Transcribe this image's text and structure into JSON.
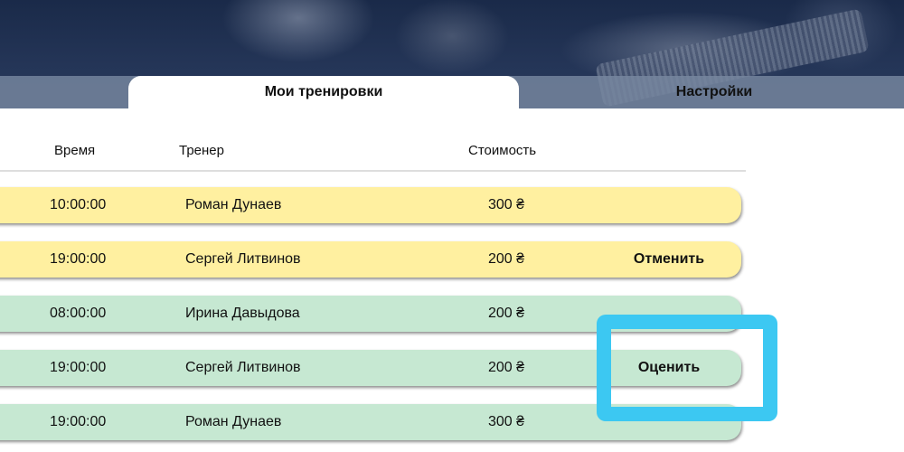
{
  "tabs": {
    "my_trainings": "Мои тренировки",
    "settings": "Настройки"
  },
  "table": {
    "headers": {
      "time": "Время",
      "trainer": "Тренер",
      "cost": "Стоимость"
    },
    "rows": [
      {
        "time": "10:00:00",
        "trainer": "Роман Дунаев",
        "cost": "300 ₴",
        "action": "",
        "status": "upcoming"
      },
      {
        "time": "19:00:00",
        "trainer": "Сергей Литвинов",
        "cost": "200 ₴",
        "action": "Отменить",
        "status": "upcoming"
      },
      {
        "time": "08:00:00",
        "trainer": "Ирина Давыдова",
        "cost": "200 ₴",
        "action": "",
        "status": "completed"
      },
      {
        "time": "19:00:00",
        "trainer": "Сергей Литвинов",
        "cost": "200 ₴",
        "action": "Оценить",
        "status": "completed"
      },
      {
        "time": "19:00:00",
        "trainer": "Роман Дунаев",
        "cost": "300 ₴",
        "action": "",
        "status": "completed"
      }
    ]
  },
  "colors": {
    "upcoming_row": "#fff0a0",
    "completed_row": "#c6e8d2",
    "highlight": "#3cc8f2",
    "header_bg": "#1a2a49"
  }
}
